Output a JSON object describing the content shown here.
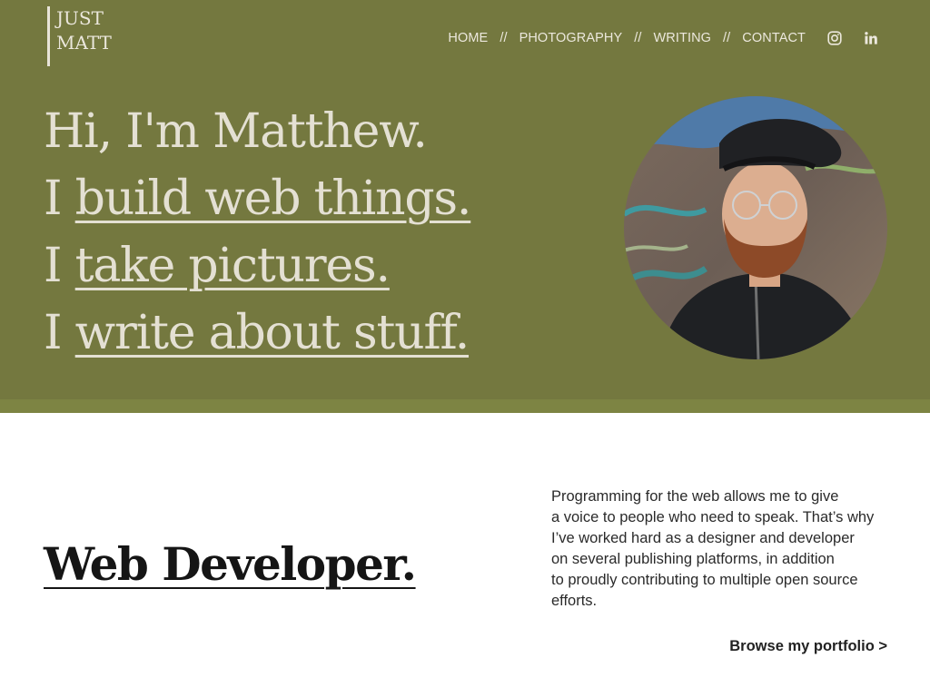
{
  "header": {
    "logo_line1": "JUST",
    "logo_line2": "MATT",
    "nav": {
      "home": "HOME",
      "photography": "PHOTOGRAPHY",
      "writing": "WRITING",
      "contact": "CONTACT",
      "separator": "//"
    },
    "social": [
      "instagram-icon",
      "linkedin-icon"
    ]
  },
  "hero": {
    "greeting": "Hi, I'm Matthew.",
    "line2_prefix": "I ",
    "line2_link": "build web things.",
    "line3_prefix": "I ",
    "line3_link": "take pictures.",
    "line4_prefix": "I ",
    "line4_link": "write about stuff."
  },
  "section": {
    "title": "Web Developer.",
    "paragraph_lines": [
      "Programming for the web allows me to give",
      "a voice to people who need to speak. That’s why",
      "I’ve worked hard as a designer and developer",
      "on several publishing platforms, in addition",
      "to proudly contributing to multiple open source",
      "efforts."
    ],
    "cta": "Browse my portfolio >"
  },
  "colors": {
    "hero_bg": "#74783f",
    "hero_strip": "#7d8443",
    "hero_text": "#e4e0d3",
    "body_text": "#151515"
  }
}
